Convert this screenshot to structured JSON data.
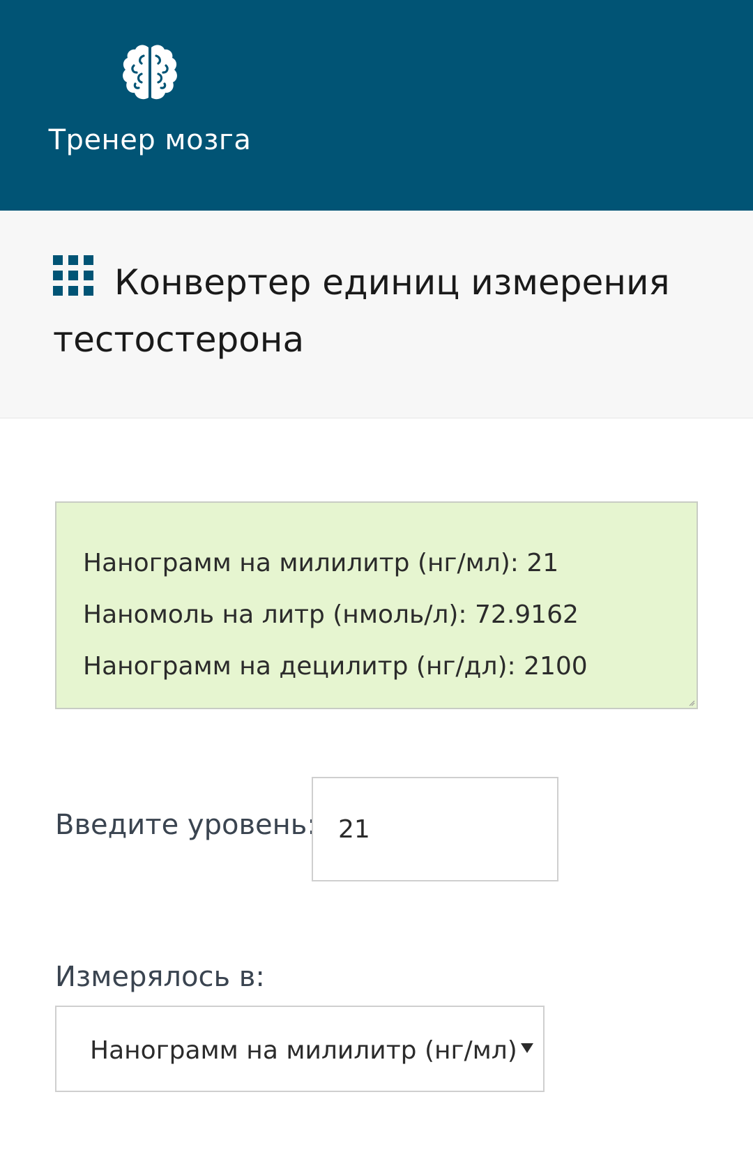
{
  "header": {
    "app_name": "Тренер мозга",
    "logo_icon": "brain-icon",
    "background_color": "#015475"
  },
  "title": {
    "icon": "grid-icon",
    "text": "Конвертер единиц измерения тестостерона"
  },
  "results": {
    "background_color": "#e6f5d0",
    "lines": [
      "Нанограмм на мililитр (нг/мл): 21",
      "Наномоль на литр (нмоль/л): 72.9162",
      "Нанограмм на децилитр (нг/дл): 2100"
    ]
  },
  "level": {
    "label": "Введите уровень:",
    "value": "21"
  },
  "measured_in": {
    "label": "Измерялось в:",
    "selected": "Нанограмм на милилитр (нг/мл)",
    "arrow_icon": "chevron-down-icon"
  }
}
